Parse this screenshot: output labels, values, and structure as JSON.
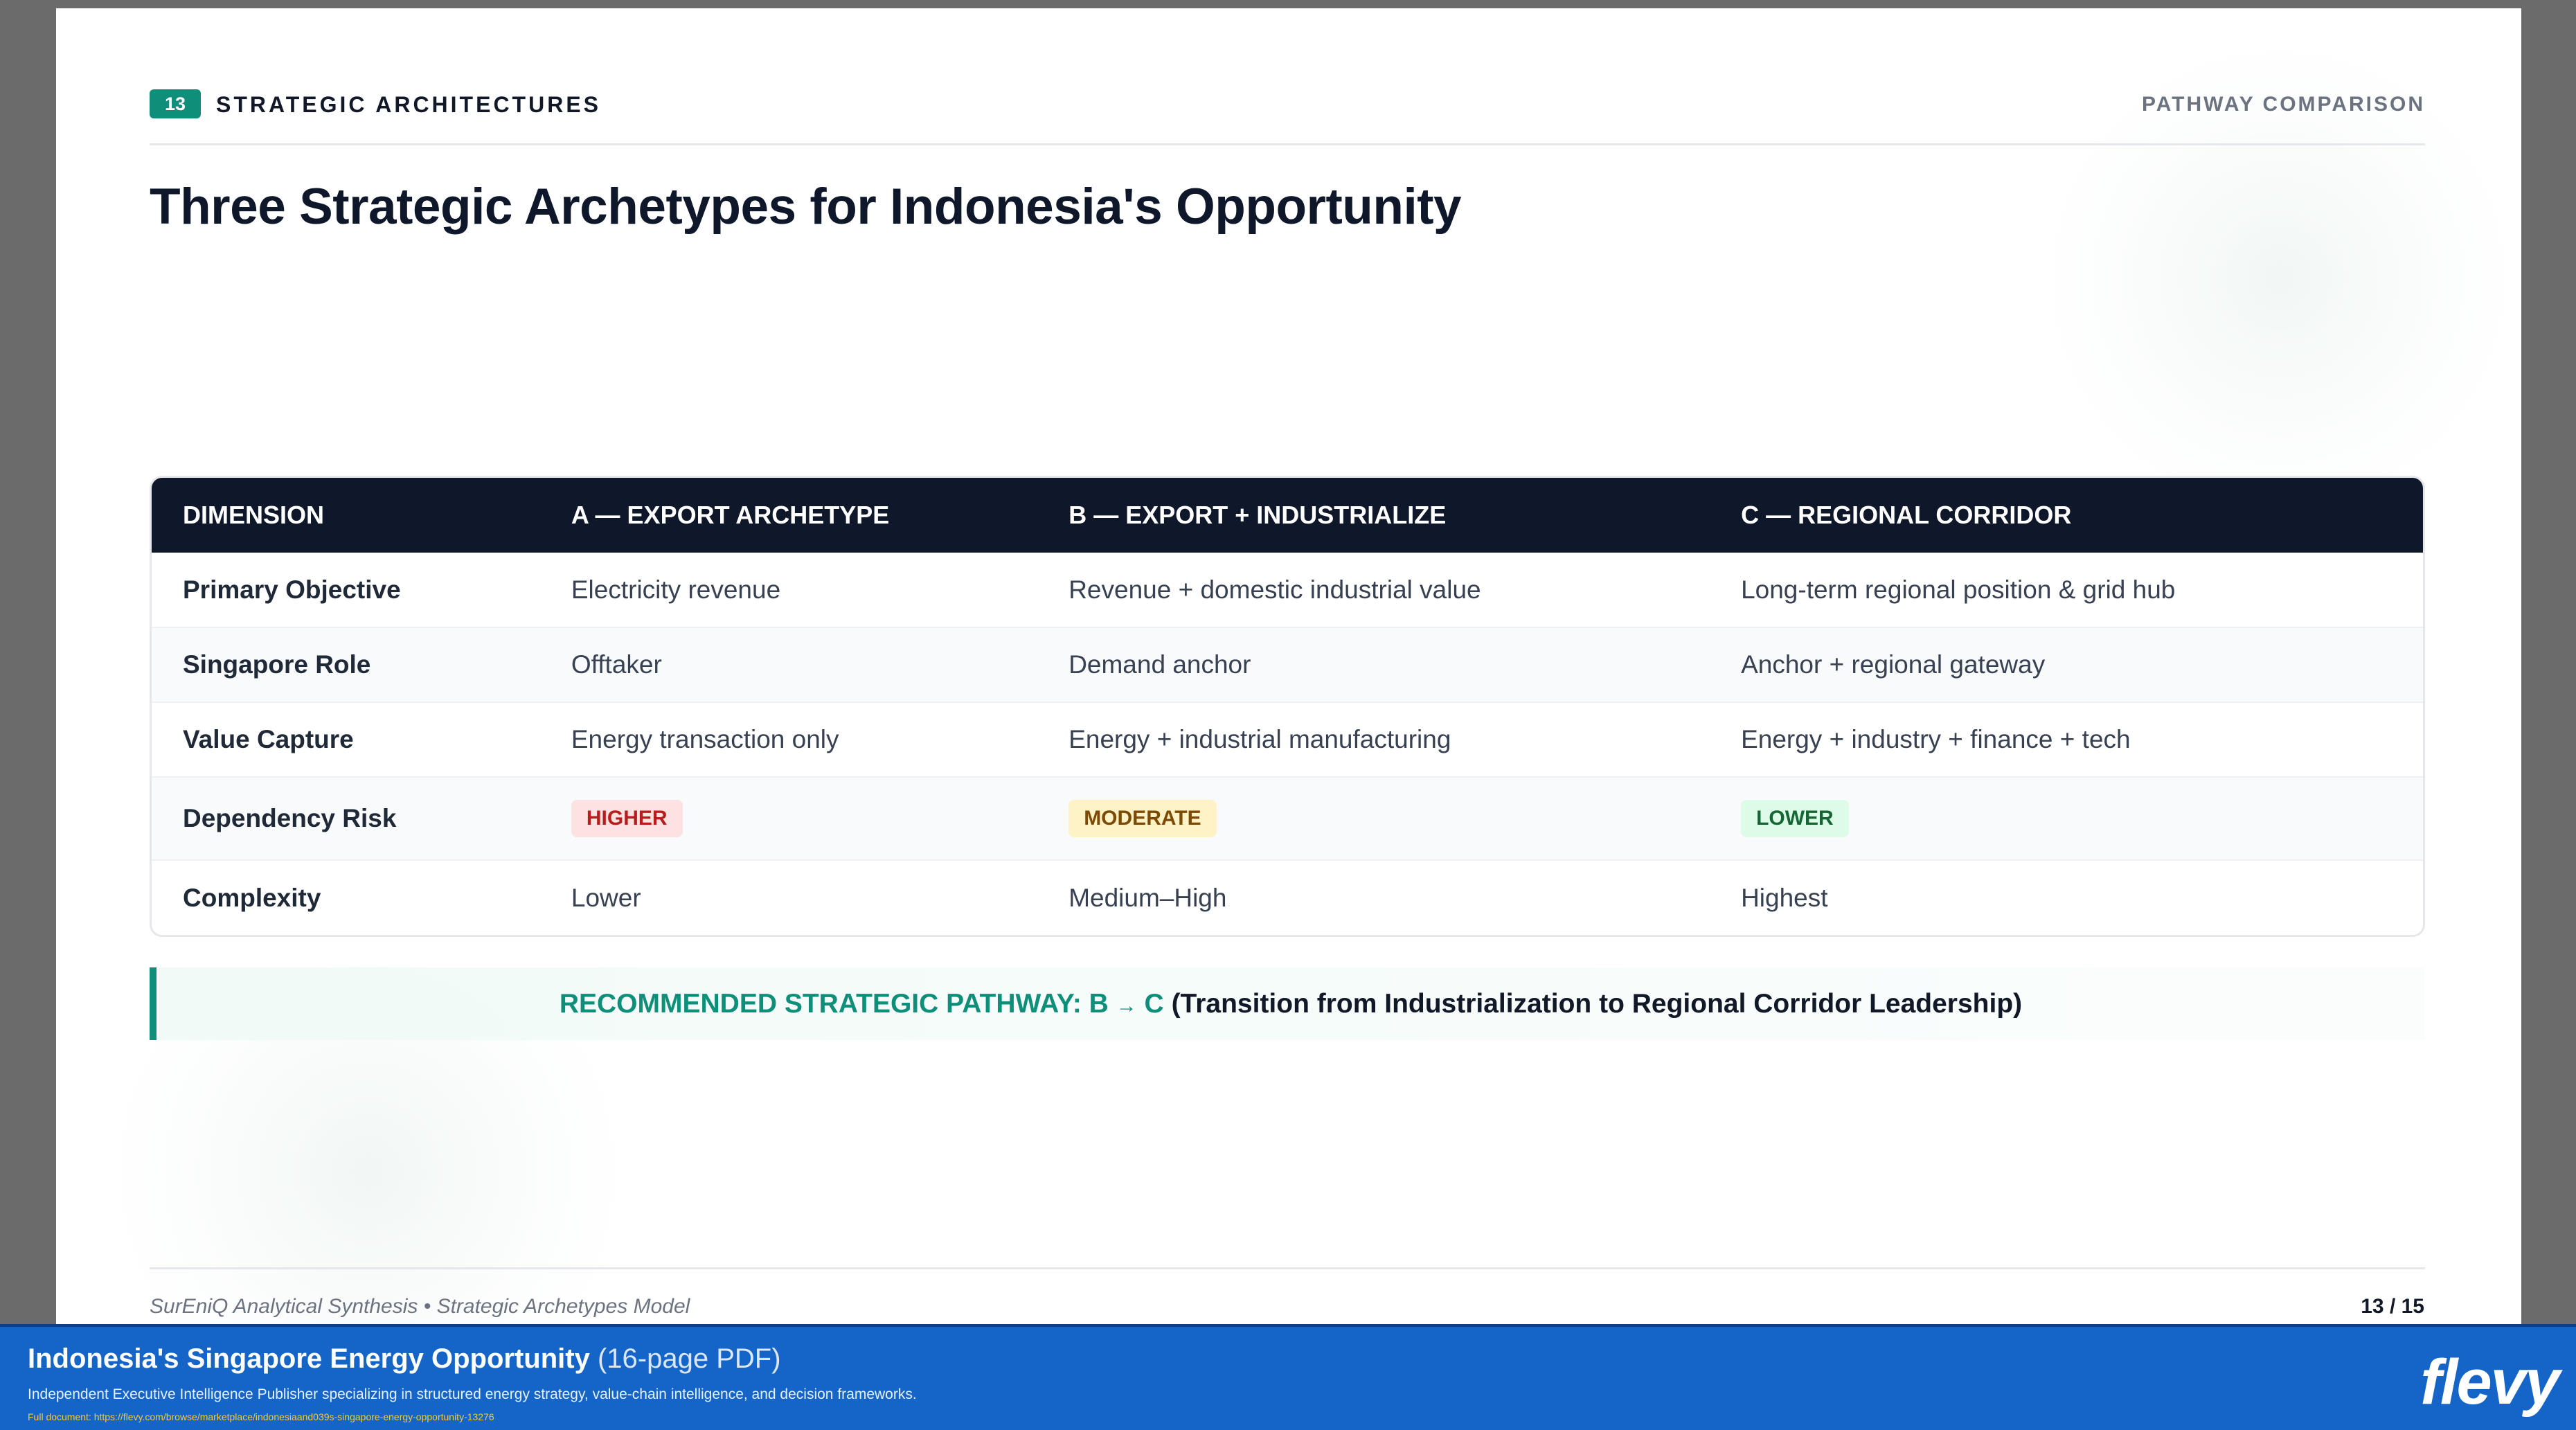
{
  "slide": {
    "section_number": "13",
    "section_label": "STRATEGIC ARCHITECTURES",
    "header_right": "PATHWAY COMPARISON",
    "title": "Three Strategic Archetypes for Indonesia's Opportunity"
  },
  "table": {
    "columns": [
      "DIMENSION",
      "A — EXPORT ARCHETYPE",
      "B — EXPORT + INDUSTRIALIZE",
      "C — REGIONAL CORRIDOR"
    ],
    "rows": [
      {
        "dimension": "Primary Objective",
        "a": "Electricity revenue",
        "b": "Revenue + domestic industrial value",
        "c": "Long-term regional position & grid hub"
      },
      {
        "dimension": "Singapore Role",
        "a": "Offtaker",
        "b": "Demand anchor",
        "c": "Anchor + regional gateway"
      },
      {
        "dimension": "Value Capture",
        "a": "Energy transaction only",
        "b": "Energy + industrial manufacturing",
        "c": "Energy + industry + finance + tech"
      },
      {
        "dimension": "Dependency Risk",
        "a": "HIGHER",
        "b": "MODERATE",
        "c": "LOWER"
      },
      {
        "dimension": "Complexity",
        "a": "Lower",
        "b": "Medium–High",
        "c": "Highest"
      }
    ],
    "badge_colors": {
      "higher": {
        "bg": "#fde2e2",
        "fg": "#b91c1c"
      },
      "moderate": {
        "bg": "#fef3c7",
        "fg": "#7c4a03"
      },
      "lower": {
        "bg": "#dcfce7",
        "fg": "#166534"
      }
    }
  },
  "recommendation": {
    "prefix": "RECOMMENDED STRATEGIC PATHWAY: B",
    "arrow": "→",
    "suffix": "C",
    "note": "(Transition from Industrialization to Regional Corridor Leadership)"
  },
  "footer": {
    "left": "SurEniQ Analytical Synthesis • Strategic Archetypes Model",
    "page": "13 / 15"
  },
  "banner": {
    "title_strong": "Indonesia's Singapore Energy Opportunity",
    "title_light": "(16-page PDF)",
    "description": "Independent Executive Intelligence Publisher specializing in structured energy strategy, value-chain intelligence, and decision frameworks.",
    "link": "Full document: https://flevy.com/browse/marketplace/indonesiaand039s-singapore-energy-opportunity-13276",
    "logo": "flevy"
  },
  "colors": {
    "accent": "#0f8f7a",
    "header_bg": "#0f172a",
    "banner_bg": "#1565c8"
  }
}
